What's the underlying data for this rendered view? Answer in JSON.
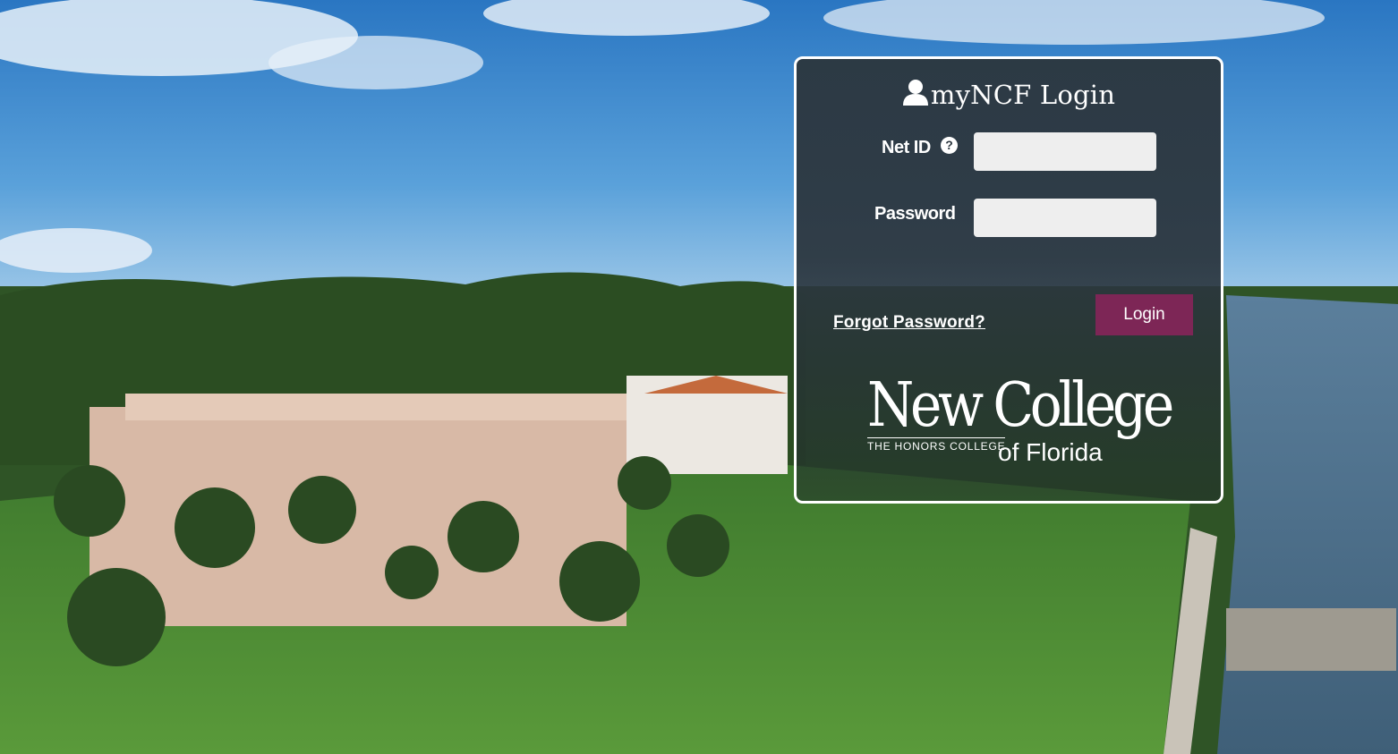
{
  "login": {
    "title": "myNCF Login",
    "netid_label": "Net ID",
    "help_glyph": "?",
    "password_label": "Password",
    "netid_value": "",
    "password_value": "",
    "forgot_link": "Forgot Password?",
    "login_button": "Login"
  },
  "logo": {
    "name": "New College",
    "tagline": "THE HONORS COLLEGE",
    "location": "of Florida"
  },
  "colors": {
    "panel": "#2c3740",
    "login_button": "#7d2656",
    "input": "#eeeeee"
  },
  "icons": {
    "title": "user-icon",
    "netid_help": "question-circle-icon"
  }
}
